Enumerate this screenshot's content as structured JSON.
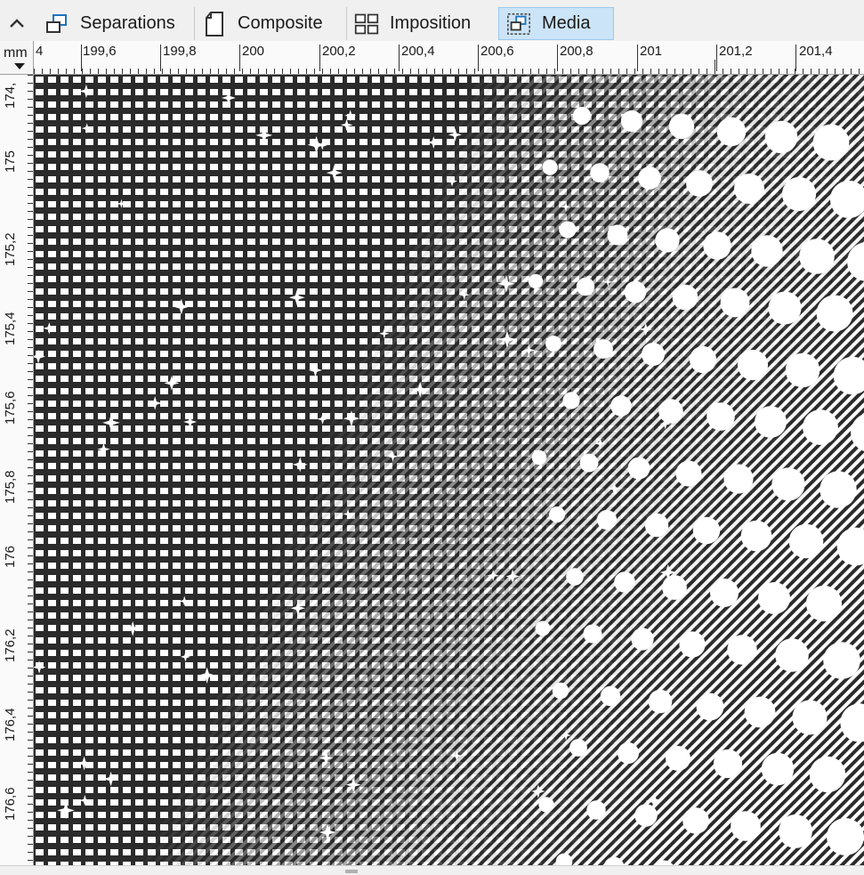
{
  "tabs": [
    {
      "label": "Separations",
      "icon": "separations-icon",
      "active": false
    },
    {
      "label": "Composite",
      "icon": "composite-icon",
      "active": false
    },
    {
      "label": "Imposition",
      "icon": "imposition-icon",
      "active": false
    },
    {
      "label": "Media",
      "icon": "media-icon",
      "active": true
    }
  ],
  "ruler": {
    "unit": "mm",
    "top_labels": [
      "4",
      "199,6",
      "199,8",
      "200",
      "200,2",
      "200,4",
      "200,6",
      "200,8",
      "201",
      "201,2",
      "201,4"
    ],
    "left_labels": [
      "174,",
      "175",
      "175,2",
      "175,4",
      "175,6",
      "175,8",
      "176",
      "176,2",
      "176,4",
      "176,6"
    ]
  },
  "colors": {
    "accent": "#cce4f7",
    "ink": "#2b2b2b",
    "paper": "#ffffff"
  }
}
